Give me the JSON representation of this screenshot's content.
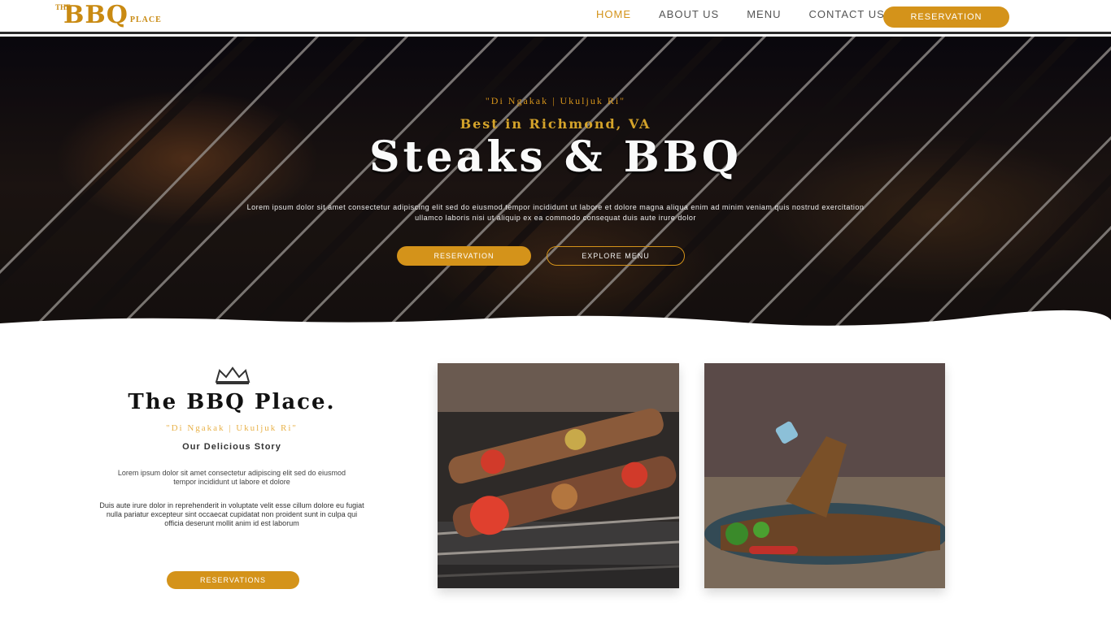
{
  "nav": {
    "logo": {
      "the": "THE",
      "main": "BBQ",
      "suffix": "PLACE"
    },
    "links": [
      {
        "label": "Home",
        "active": true
      },
      {
        "label": "About Us",
        "active": false
      },
      {
        "label": "Menu",
        "active": false
      },
      {
        "label": "Contact Us",
        "active": false
      }
    ],
    "cta": "Reservation"
  },
  "hero": {
    "tagline": "\"Di Ngakak | Ukuljuk Ri\"",
    "subtitle": "Best in Richmond, VA",
    "title": "Steaks & BBQ",
    "description": "Lorem ipsum dolor sit amet consectetur adipiscing elit sed do eiusmod tempor incididunt ut labore et dolore magna aliqua enim ad minim veniam quis nostrud exercitation ullamco laboris nisi ut aliquip ex ea commodo consequat duis aute irure dolor",
    "button_primary": "Reservation",
    "button_secondary": "Explore Menu"
  },
  "about": {
    "title": "The BBQ Place.",
    "tagline": "\"Di Ngakak | Ukuljuk Ri\"",
    "heading": "Our Delicious Story",
    "paragraph1": "Lorem ipsum dolor sit amet consectetur adipiscing elit sed do eiusmod tempor incididunt ut labore et dolore",
    "paragraph2": "Duis aute irure dolor in reprehenderit in voluptate velit esse cillum dolore eu fugiat nulla pariatur excepteur sint occaecat cupidatat non proident sunt in culpa qui officia deserunt mollit anim id est laborum",
    "button": "Reservations"
  },
  "colors": {
    "accent": "#d4931a",
    "dark": "#111111"
  }
}
